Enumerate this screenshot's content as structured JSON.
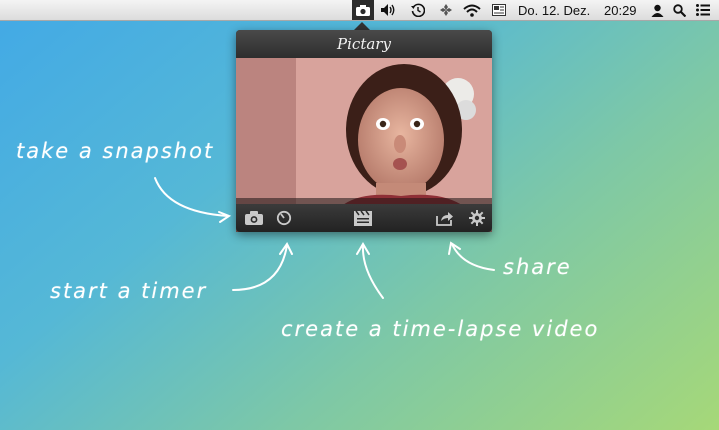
{
  "menubar": {
    "date": "Do. 12. Dez.",
    "time": "20:29",
    "icons": [
      "camera-icon",
      "volume-icon",
      "time-machine-icon",
      "dropbox-icon",
      "wifi-icon",
      "flag-icon",
      "user-icon",
      "spotlight-search-icon",
      "notification-center-icon"
    ]
  },
  "popover": {
    "title": "Pictary",
    "toolbar": [
      "take-snapshot-button",
      "timer-button",
      "time-lapse-button",
      "share-button",
      "settings-button"
    ]
  },
  "annotations": {
    "snapshot": "take a snapshot",
    "timer": "start a timer",
    "timelapse": "create a time-lapse video",
    "share": "share"
  },
  "colors": {
    "menubar": "#e8e8e8",
    "popover": "#2d2d2d",
    "bg_start": "#42a9e6",
    "bg_end": "#a6d878"
  }
}
